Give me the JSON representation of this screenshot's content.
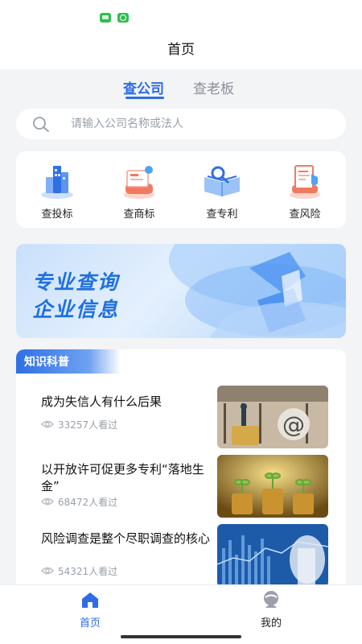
{
  "header": {
    "title": "首页"
  },
  "tabs": [
    {
      "label": "查公司",
      "active": true
    },
    {
      "label": "查老板",
      "active": false
    }
  ],
  "search": {
    "placeholder": "请输入公司名称或法人",
    "value": ""
  },
  "features": [
    {
      "label": "查投标",
      "icon": "building-chart-icon"
    },
    {
      "label": "查商标",
      "icon": "trademark-icon"
    },
    {
      "label": "查专利",
      "icon": "patent-book-icon"
    },
    {
      "label": "查风险",
      "icon": "risk-document-icon"
    }
  ],
  "banner": {
    "line1": "专业查询",
    "line2": "企业信息"
  },
  "knowledge": {
    "title": "知识科普",
    "articles": [
      {
        "title": "成为失信人有什么后果",
        "views": "33257人看过"
      },
      {
        "title": "以开放许可促更多专利“落地生金”",
        "views": "68472人看过"
      },
      {
        "title": "风险调查是整个尽职调查的核心",
        "views": "54321人看过"
      }
    ]
  },
  "tabbar": [
    {
      "label": "首页",
      "active": true,
      "icon": "home-icon"
    },
    {
      "label": "我的",
      "active": false,
      "icon": "profile-icon"
    }
  ],
  "colors": {
    "accent": "#2e6be6",
    "background": "#f3f4f6",
    "muted": "#9aa0a8"
  }
}
